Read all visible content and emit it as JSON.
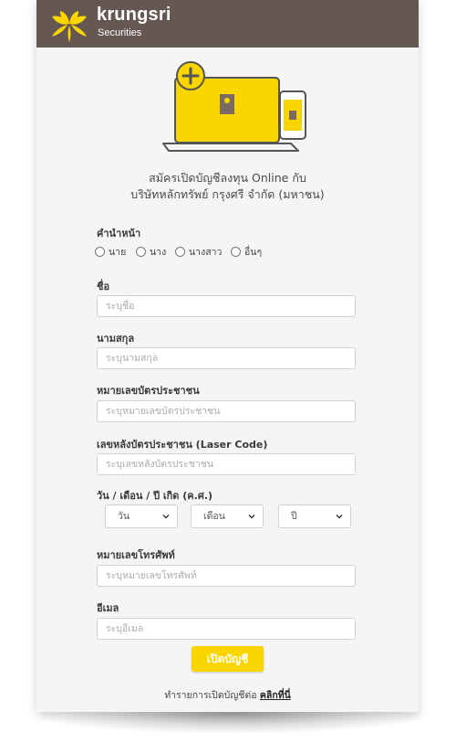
{
  "brand": {
    "name": "krungsri",
    "sub": "Securities"
  },
  "headline": {
    "line1": "สมัครเปิดบัญชีลงทุน Online กับ",
    "line2": "บริษัทหลักทรัพย์ กรุงศรี จำกัด (มหาชน)"
  },
  "form": {
    "prefix": {
      "label": "คำนำหน้า",
      "options": [
        "นาย",
        "นาง",
        "นางสาว",
        "อื่นๆ"
      ]
    },
    "first_name": {
      "label": "ชื่อ",
      "placeholder": "ระบุชื่อ"
    },
    "last_name": {
      "label": "นามสกุล",
      "placeholder": "ระบุนามสกุล"
    },
    "id_card": {
      "label": "หมายเลขบัตรประชาชน",
      "placeholder": "ระบุหมายเลขบัตรประชาชน"
    },
    "laser_code": {
      "label": "เลขหลังบัตรประชาชน (Laser Code)",
      "placeholder": "ระบุเลขหลังบัตรประชาชน"
    },
    "birth": {
      "label": "วัน / เดือน / ปี เกิด (ค.ศ.)",
      "day": "วัน",
      "month": "เดือน",
      "year": "ปี"
    },
    "phone": {
      "label": "หมายเลขโทรศัพท์",
      "placeholder": "ระบุหมายเลขโทรศัพท์"
    },
    "email": {
      "label": "อีเมล",
      "placeholder": "ระบุอีเมล"
    },
    "submit": "เปิดบัญชี"
  },
  "footer": {
    "text": "ทำรายการเปิดบัญชีต่อ",
    "link": "คลิกที่นี่"
  },
  "colors": {
    "topbar": "#655751",
    "accent": "#fbd500",
    "page": "#f5f5f5"
  },
  "icons": {
    "logo": "krungsri-logo-icon",
    "hero": "laptop-phone-add-illustration",
    "chevron": "chevron-down-icon"
  }
}
